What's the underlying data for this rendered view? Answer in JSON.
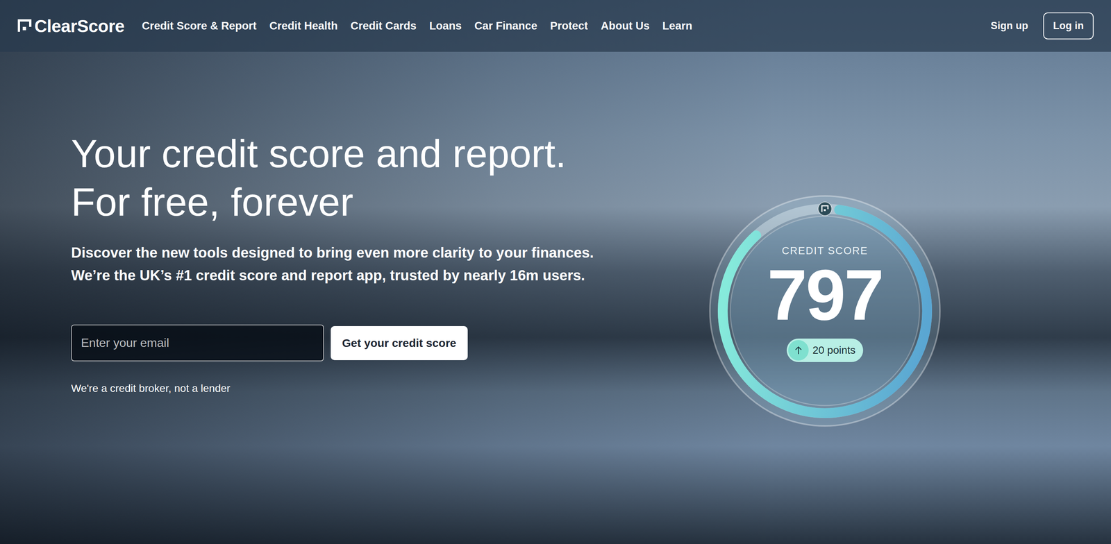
{
  "logo": "ClearScore",
  "nav": [
    "Credit Score & Report",
    "Credit Health",
    "Credit Cards",
    "Loans",
    "Car Finance",
    "Protect",
    "About Us",
    "Learn"
  ],
  "auth": {
    "signup": "Sign up",
    "login": "Log in"
  },
  "hero": {
    "title_lines": [
      "Your credit score and report.",
      "For free, forever"
    ],
    "subtitle": "Discover the new tools designed to bring even more clarity to your finances. We’re the UK’s #1 credit score and report app, trusted by nearly 16m users.",
    "email_placeholder": "Enter your email",
    "cta": "Get your credit score",
    "disclaimer": "We're a credit broker, not a lender"
  },
  "score_card": {
    "label": "CREDIT SCORE",
    "score": "797",
    "change": "20 points",
    "level": 0.86
  }
}
